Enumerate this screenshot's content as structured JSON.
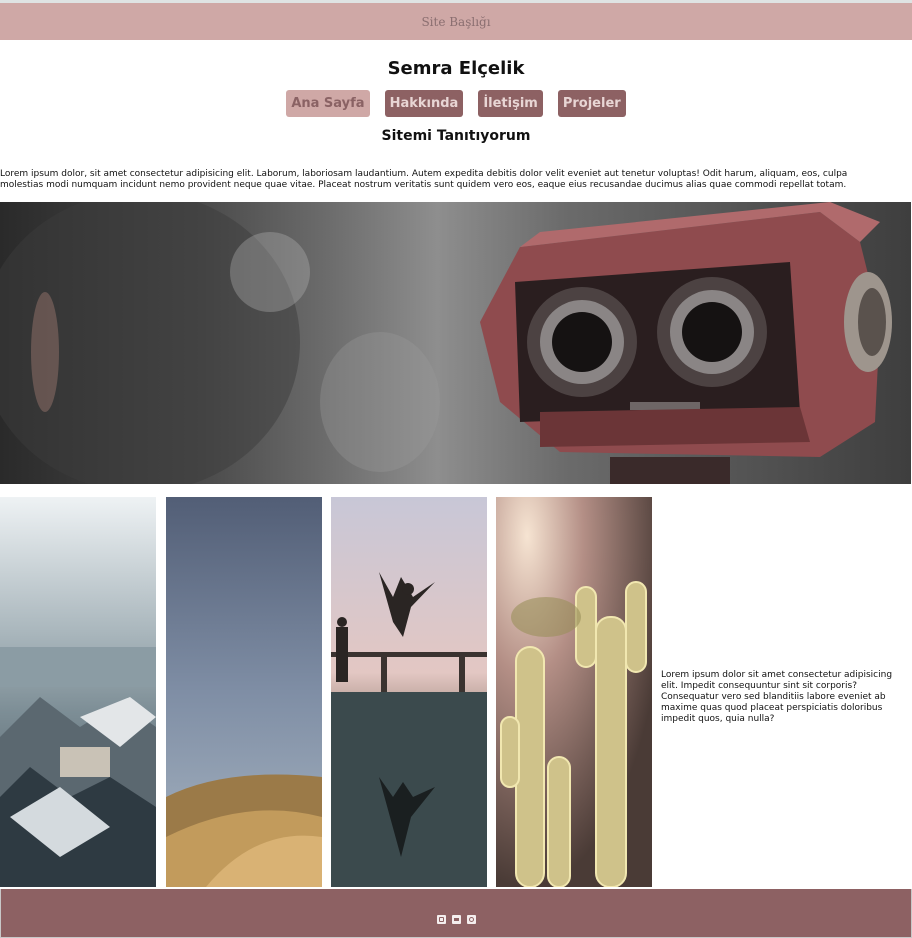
{
  "site": {
    "header_title": "Site Başlığı"
  },
  "profile": {
    "name": "Semra Elçelik"
  },
  "nav": {
    "items": [
      {
        "label": "Ana Sayfa",
        "active": true
      },
      {
        "label": "Hakkında",
        "active": false
      },
      {
        "label": "İletişim",
        "active": false
      },
      {
        "label": "Projeler",
        "active": false
      }
    ]
  },
  "content": {
    "subtitle": "Sitemi Tanıtıyorum",
    "intro": "Lorem ipsum dolor, sit amet consectetur adipisicing elit. Laborum, laboriosam laudantium. Autem expedita debitis dolor velit eveniet aut tenetur voluptas! Odit harum, aliquam, eos, culpa molestias modi numquam incidunt nemo provident neque quae vitae. Placeat nostrum veritatis sunt quidem vero eos, eaque eius recusandae ducimus alias quae commodi repellat totam.",
    "side_text": "Lorem ipsum dolor sit amet consectetur adipisicing elit. Impedit consequuntur sint sit corporis? Consequatur vero sed blanditiis labore eveniet ab maxime quas quod placeat perspiciatis doloribus impedit quos, quia nulla?"
  },
  "images": {
    "hero": "robot-binoculars-photo",
    "gallery": [
      "city-rooftops-photo",
      "desert-dune-photo",
      "jumping-person-photo",
      "cactus-photo"
    ]
  },
  "footer": {
    "icons": [
      "instagram-icon",
      "twitter-icon",
      "other-social-icon"
    ]
  },
  "colors": {
    "header_bg": "#cfa8a6",
    "nav_bg": "#8d6163",
    "nav_active_bg": "#cfa8a6",
    "footer_bg": "#8d6163"
  }
}
